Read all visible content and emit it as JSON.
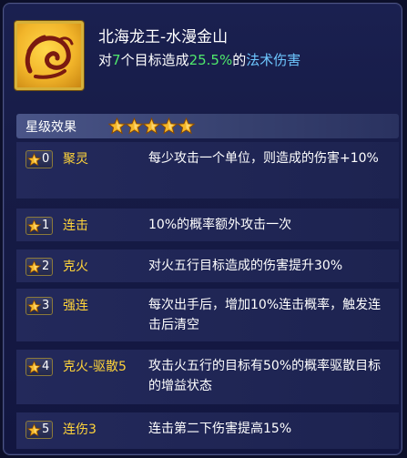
{
  "skill": {
    "name": "北海龙王-水漫金山",
    "desc_prefix": "对",
    "target_count": "7",
    "desc_mid": "个目标造成",
    "damage_percent": "25.5%",
    "desc_of": "的",
    "damage_type": "法术伤害",
    "icon": "swirl-cloud-icon"
  },
  "star_section": {
    "title": "星级效果",
    "star_count": 5,
    "star_color": "#f5b82a"
  },
  "colors": {
    "highlight_green": "#4fe86c",
    "highlight_blue": "#6ec7ff",
    "star_name_yellow": "#ffd43a"
  },
  "star_effects": [
    {
      "level": "0",
      "name": "聚灵",
      "effect": "每少攻击一个单位，则造成的伤害+10%"
    },
    {
      "level": "1",
      "name": "连击",
      "effect": "10%的概率额外攻击一次"
    },
    {
      "level": "2",
      "name": "克火",
      "effect": "对火五行目标造成的伤害提升30%"
    },
    {
      "level": "3",
      "name": "强连",
      "effect": "每次出手后，增加10%连击概率，触发连击后清空"
    },
    {
      "level": "4",
      "name": "克火-驱散5",
      "effect": "攻击火五行的目标有50%的概率驱散目标的增益状态"
    },
    {
      "level": "5",
      "name": "连伤3",
      "effect": "连击第二下伤害提高15%"
    }
  ]
}
